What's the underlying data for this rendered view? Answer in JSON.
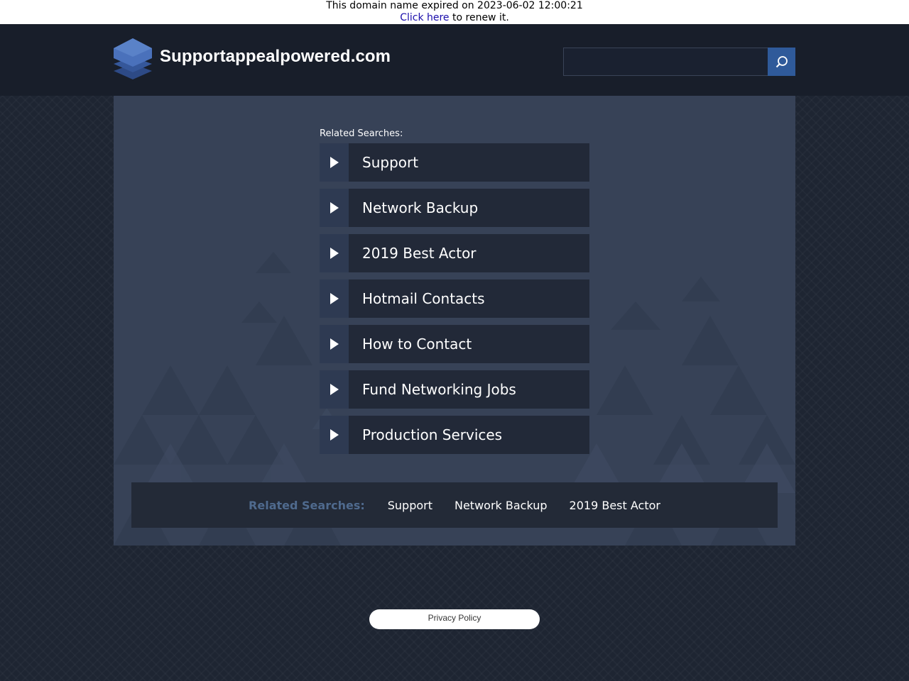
{
  "expiry_notice": {
    "message": "This domain name expired on 2023-06-02 12:00:21",
    "link_text": "Click here",
    "suffix": "to renew it."
  },
  "header": {
    "site_title": "Supportappealpowered.com",
    "logo_icon": "layers-stack-icon",
    "search_placeholder": "",
    "search_icon": "search-icon",
    "colors": {
      "header_bg": "#181e2a",
      "search_button": "#2f5a9a"
    }
  },
  "related": {
    "label": "Related Searches:",
    "items": [
      {
        "label": "Support"
      },
      {
        "label": "Network Backup"
      },
      {
        "label": "2019 Best Actor"
      },
      {
        "label": "Hotmail Contacts"
      },
      {
        "label": "How to Contact"
      },
      {
        "label": "Fund Networking Jobs"
      },
      {
        "label": "Production Services"
      }
    ]
  },
  "bottom_bar": {
    "label": "Related Searches:",
    "links": [
      "Support",
      "Network Backup",
      "2019 Best Actor"
    ]
  },
  "footer": {
    "privacy_label": "Privacy Policy"
  }
}
